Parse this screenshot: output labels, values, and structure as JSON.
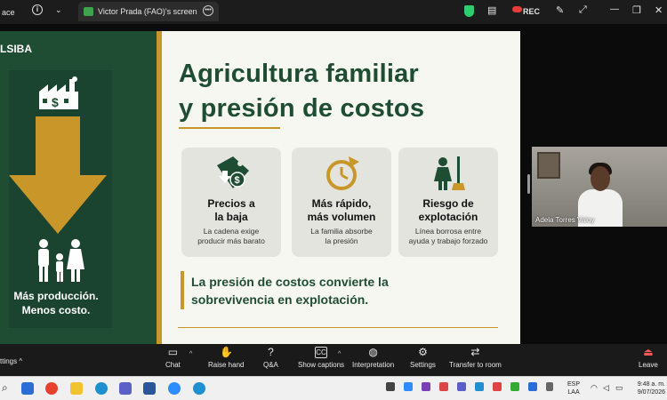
{
  "topbar": {
    "left_fragment": "ace",
    "tab_title": "Victor Prada (FAO)'s screen",
    "rec_label": "REC"
  },
  "slide": {
    "brand": "LSIBA",
    "title_line1": "Agricultura familiar",
    "title_line2": "y presión de costos",
    "left_tagline_line1": "Más producción.",
    "left_tagline_line2": "Menos costo.",
    "cards": [
      {
        "title_line1": "Precios a",
        "title_line2": "la baja",
        "desc_line1": "La cadena exige",
        "desc_line2": "producir más barato",
        "icon": "price-tag-down-icon"
      },
      {
        "title_line1": "Más rápido,",
        "title_line2": "más volumen",
        "desc_line1": "La familia absorbe",
        "desc_line2": "la presión",
        "icon": "clock-arrow-icon"
      },
      {
        "title_line1": "Riesgo de",
        "title_line2": "explotación",
        "desc_line1": "Línea borrosa entre",
        "desc_line2": "ayuda y trabajo forzado",
        "icon": "child-broom-icon"
      }
    ],
    "quote_line1": "La presión de costos convierte la",
    "quote_line2": "sobrevivencia en explotación."
  },
  "video": {
    "participant_name": "Adela Torres Valoy"
  },
  "meeting_toolbar": {
    "settings_fragment": "ttings",
    "buttons": [
      {
        "label": "Chat",
        "icon": "chat-icon"
      },
      {
        "label": "Raise hand",
        "icon": "hand-icon"
      },
      {
        "label": "Q&A",
        "icon": "qa-icon"
      },
      {
        "label": "Show captions",
        "icon": "captions-icon"
      },
      {
        "label": "Interpretation",
        "icon": "globe-icon"
      },
      {
        "label": "Settings",
        "icon": "gear-icon"
      },
      {
        "label": "Transfer to room",
        "icon": "transfer-icon"
      },
      {
        "label": "Leave",
        "icon": "leave-icon"
      }
    ]
  },
  "taskbar": {
    "lang_line1": "ESP",
    "lang_line2": "LAA",
    "time": "9:48 a. m.",
    "date": "9/07/2026"
  },
  "colors": {
    "brand_green": "#1f4d33",
    "gold": "#c9962a",
    "slide_bg": "#f7f7f2",
    "card_bg": "#e4e4de"
  }
}
